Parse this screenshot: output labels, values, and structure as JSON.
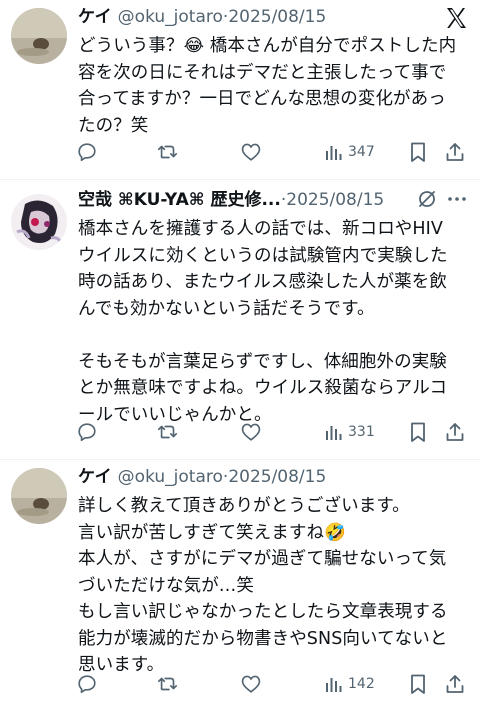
{
  "top_right_icon": "x-logo-icon",
  "tweets": [
    {
      "name": "ケイ",
      "handle": "@oku_jotaro",
      "separator": "·",
      "date": "2025/08/15",
      "lines": [
        "どういう事？😂 橋本さんが自分でポストした内",
        "容を次の日にそれはデマだと主張したって事で",
        "合ってますか？一日でどんな思想の変化があっ",
        "たの？笑"
      ],
      "views": "347"
    },
    {
      "name": "空哉 ⌘KU-YA⌘ 歴史修...",
      "handle": "",
      "separator": "·",
      "date": "2025/08/15",
      "lines": [
        "橋本さんを擁護する人の話では、新コロやHIV",
        "ウイルスに効くというのは試験管内で実験した",
        "時の話あり、またウイルス感染した人が薬を飲",
        "んでも効かないという話だそうです。",
        "",
        "そもそもが言葉足らずですし、体細胞外の実験",
        "とか無意味ですよね。ウイルス殺菌ならアルコ",
        "ールでいいじゃんかと。"
      ],
      "views": "331"
    },
    {
      "name": "ケイ",
      "handle": "@oku_jotaro",
      "separator": "·",
      "date": "2025/08/15",
      "lines": [
        "詳しく教えて頂きありがとうございます。",
        "言い訳が苦しすぎて笑えますね🤣",
        "本人が、さすがにデマが過ぎて騙せないって気",
        "づいただけな気が…笑",
        "もし言い訳じゃなかったとしたら文章表現する",
        "能力が壊滅的だから物書きやSNS向いてないと",
        "思います。"
      ],
      "views": "142"
    }
  ]
}
